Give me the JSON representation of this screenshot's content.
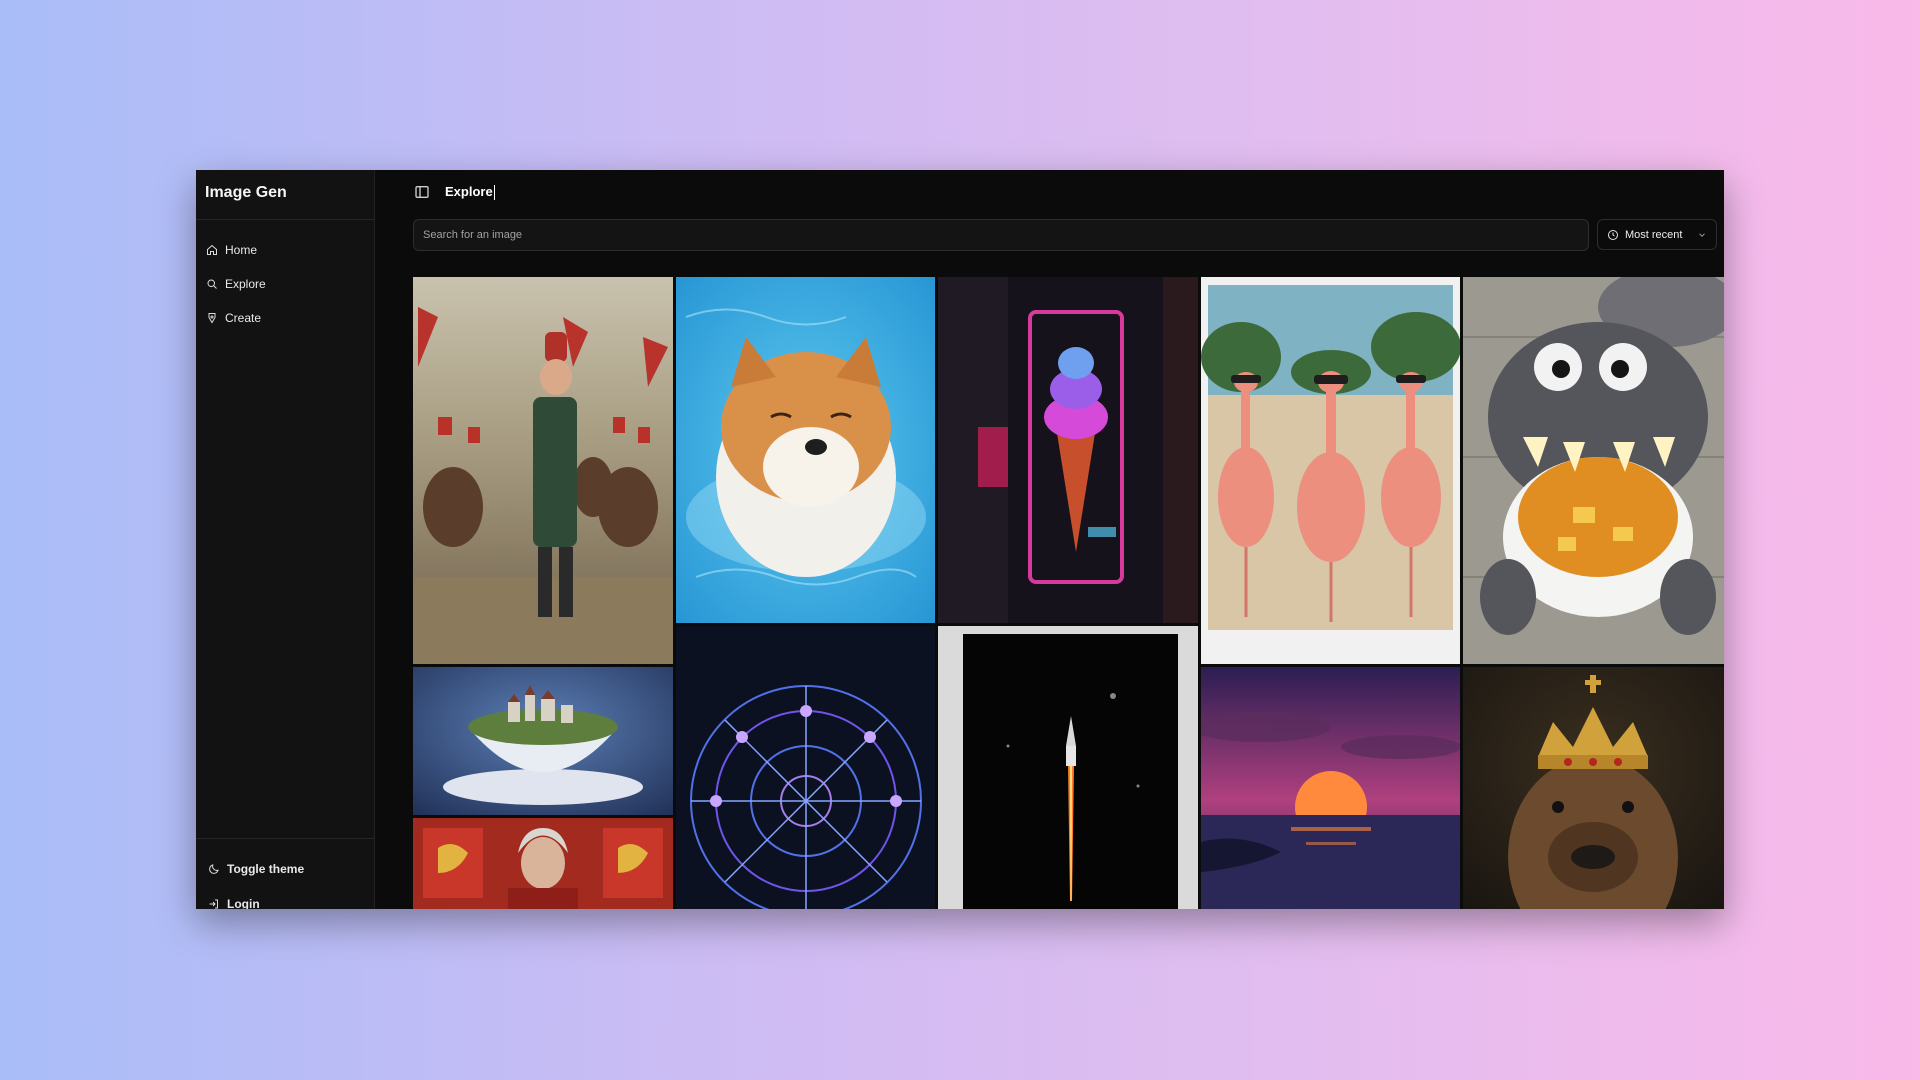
{
  "app": {
    "brand": "Image Gen"
  },
  "sidebar": {
    "items": [
      {
        "label": "Home",
        "icon": "home-icon"
      },
      {
        "label": "Explore",
        "icon": "search-icon"
      },
      {
        "label": "Create",
        "icon": "pen-icon"
      }
    ],
    "toggle_theme": "Toggle theme",
    "login": "Login"
  },
  "header": {
    "title": "Explore"
  },
  "search": {
    "placeholder": "Search for an image",
    "value": ""
  },
  "sort": {
    "label": "Most recent"
  },
  "gallery": {
    "images": [
      {
        "name": "soldier-painting"
      },
      {
        "name": "shiba-swimming"
      },
      {
        "name": "neon-ice-cream"
      },
      {
        "name": "flamingos-sunglasses"
      },
      {
        "name": "crochet-monster-soup"
      },
      {
        "name": "teacup-village"
      },
      {
        "name": "knight-banner-painting"
      },
      {
        "name": "zodiac-circle"
      },
      {
        "name": "rocket-launch"
      },
      {
        "name": "synthwave-sunset"
      },
      {
        "name": "capybara-crown"
      }
    ]
  }
}
